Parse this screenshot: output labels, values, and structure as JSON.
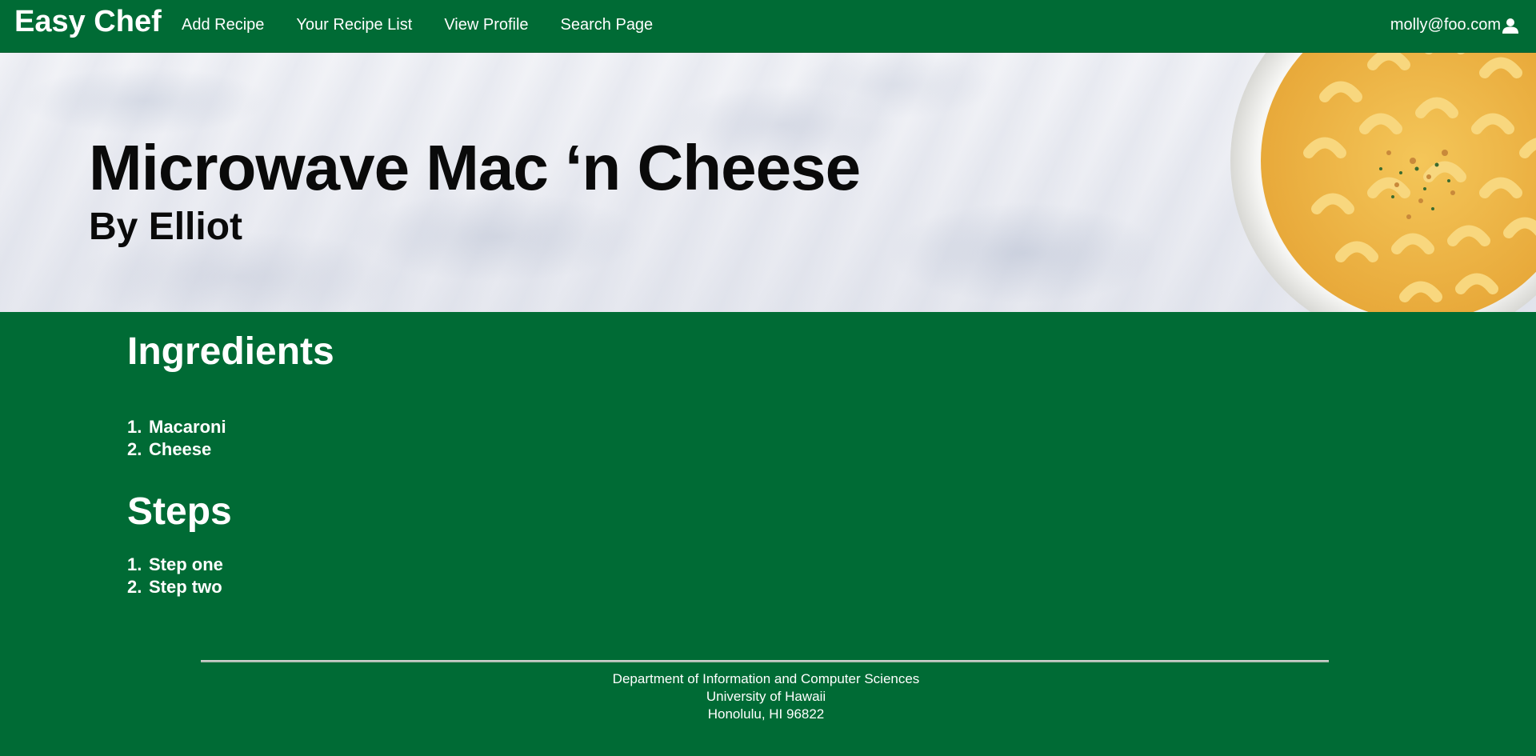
{
  "navbar": {
    "brand": "Easy Chef",
    "links": [
      "Add Recipe",
      "Your Recipe List",
      "View Profile",
      "Search Page"
    ],
    "user_email": "molly@foo.com"
  },
  "recipe": {
    "title": "Microwave Mac ‘n Cheese",
    "author": "By Elliot",
    "ingredients_heading": "Ingredients",
    "ingredients": [
      {
        "num": "1.",
        "text": "Macaroni"
      },
      {
        "num": "2.",
        "text": "Cheese"
      }
    ],
    "steps_heading": "Steps",
    "steps": [
      {
        "num": "1.",
        "text": "Step one"
      },
      {
        "num": "2.",
        "text": "Step two"
      }
    ]
  },
  "footer": {
    "lines": [
      "Department of Information and Computer Sciences",
      "University of Hawaii",
      "Honolulu, HI 96822"
    ]
  },
  "colors": {
    "brand_green": "#006b35",
    "text_dark": "#0a0a0a",
    "text_light": "#ffffff"
  },
  "icons": {
    "user": "user-icon"
  }
}
